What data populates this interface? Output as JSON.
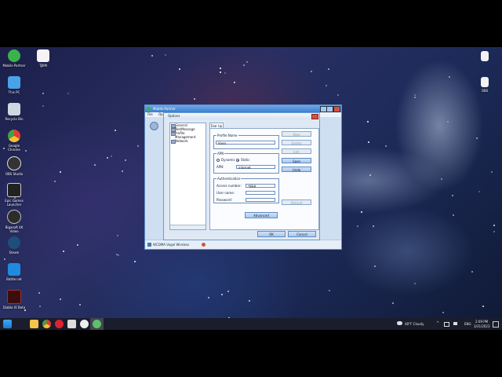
{
  "desktop": {
    "icons_left": [
      {
        "label": "Mobile Partner",
        "color": "#3bb34a"
      },
      {
        "label": "This PC",
        "color": "#4aa3e8"
      },
      {
        "label": "Recycle Bin",
        "color": "#cfd8e0"
      },
      {
        "label": "Google Chrome",
        "color": "#e9b02a"
      },
      {
        "label": "OBS Studio",
        "color": "#333333"
      },
      {
        "label": "Epic Games Launcher",
        "color": "#222222"
      },
      {
        "label": "Bigasoft 4K Video",
        "color": "#2c2c2c"
      },
      {
        "label": "Steam",
        "color": "#1d4f7a"
      },
      {
        "label": "Battle.net",
        "color": "#1f8ae0"
      },
      {
        "label": "Diablo IV Beta",
        "color": "#3a0e0e"
      }
    ],
    "icons_col2": [
      {
        "label": "TRIM",
        "color": "#ffffff"
      }
    ],
    "icons_right": [
      {
        "label": "",
        "color": "#f2f2f2"
      },
      {
        "label": "OBS",
        "color": "#f2f2f2"
      }
    ]
  },
  "main_window": {
    "title": "Mobile Partner",
    "menu": [
      "File",
      "Operations"
    ],
    "status_text": "WCDMA  Vogel Wireless"
  },
  "options_dialog": {
    "title": "Options",
    "tree": [
      "General",
      "TextMessage",
      "Profile Management",
      "Network"
    ],
    "tab": "Dial-Up",
    "profile_group_label": "Profile Name",
    "profile_name_value": "Vuoo",
    "apn_group_label": "APN",
    "apn_dynamic_label": "Dynamic",
    "apn_static_label": "Static",
    "apn_label": "APN:",
    "apn_value": "internet",
    "auth_group_label": "Authentication",
    "access_number_label": "Access number:",
    "access_number_value": "*99#",
    "username_label": "User name:",
    "username_value": "",
    "password_label": "Password:",
    "password_value": "",
    "advanced_label": "Advanced",
    "side_buttons": [
      "New",
      "Delete",
      "Edit",
      "Save",
      "Undo",
      "Default"
    ],
    "ok_label": "OK",
    "cancel_label": "Cancel"
  },
  "taskbar": {
    "weather": "48°F  Cloudy",
    "language": "ENG",
    "time": "2:09 PM",
    "date": "3/31/2023"
  }
}
